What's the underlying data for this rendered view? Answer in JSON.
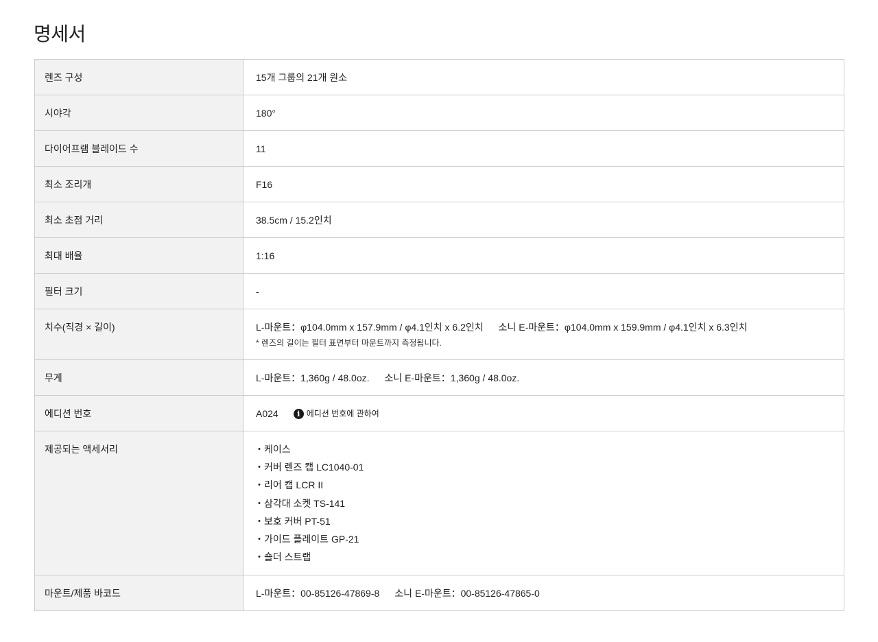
{
  "page": {
    "title": "명세서"
  },
  "specs": {
    "lens_construction": {
      "label": "렌즈 구성",
      "value": "15개 그룹의 21개 원소"
    },
    "angle_of_view": {
      "label": "시야각",
      "value": "180°"
    },
    "diaphragm_blades": {
      "label": "다이어프램 블레이드 수",
      "value": "11"
    },
    "min_aperture": {
      "label": "최소 조리개",
      "value": "F16"
    },
    "min_focus": {
      "label": "최소 초점 거리",
      "value": "38.5cm / 15.2인치"
    },
    "max_magnification": {
      "label": "최대 배율",
      "value": "1:16"
    },
    "filter_size": {
      "label": "필터 크기",
      "value": "-"
    },
    "dimensions": {
      "label": "치수(직경 × 길이)",
      "l_mount": "L-마운트：φ104.0mm x 157.9mm / φ4.1인치 x 6.2인치",
      "sony_e": "소니 E-마운트：φ104.0mm x 159.9mm / φ4.1인치 x 6.3인치",
      "note": "* 렌즈의 길이는 필터 표면부터 마운트까지 측정됩니다."
    },
    "weight": {
      "label": "무게",
      "l_mount": "L-마운트：1,360g / 48.0oz.",
      "sony_e": "소니 E-마운트：1,360g / 48.0oz."
    },
    "edition": {
      "label": "에디션 번호",
      "value": "A024",
      "info_icon": "info-icon",
      "info_link": "에디션 번호에 관하여"
    },
    "accessories": {
      "label": "제공되는 액세서리",
      "bullet": "・",
      "items": [
        "케이스",
        "커버 렌즈 캡 LC1040-01",
        "리어 캡 LCR II",
        "삼각대 소켓 TS-141",
        "보호 커버 PT-51",
        "가이드 플레이트 GP-21",
        "숄더 스트랩"
      ]
    },
    "barcode": {
      "label": "마운트/제품 바코드",
      "l_mount": "L-마운트：00-85126-47869-8",
      "sony_e": "소니 E-마운트：00-85126-47865-0"
    }
  }
}
